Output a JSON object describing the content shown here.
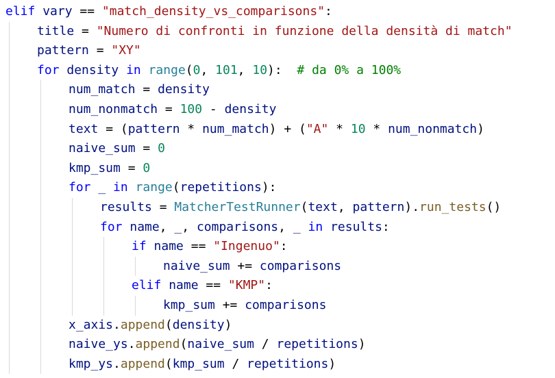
{
  "colors": {
    "keyword": "#0000ff",
    "control": "#8f08c4",
    "identifier": "#001080",
    "string": "#a31515",
    "number": "#098658",
    "comment": "#008000",
    "function": "#795e26",
    "class": "#267f99",
    "plain": "#000000",
    "guide": "#d9d9d9"
  },
  "lines": [
    {
      "indent": 0,
      "tokens": [
        {
          "t": "elif",
          "k": "keyword"
        },
        {
          "t": " ",
          "k": "plain"
        },
        {
          "t": "vary",
          "k": "identifier"
        },
        {
          "t": " == ",
          "k": "plain"
        },
        {
          "t": "\"match_density_vs_comparisons\"",
          "k": "string"
        },
        {
          "t": ":",
          "k": "plain"
        }
      ]
    },
    {
      "indent": 1,
      "tokens": [
        {
          "t": "title",
          "k": "identifier"
        },
        {
          "t": " = ",
          "k": "plain"
        },
        {
          "t": "\"Numero di confronti in funzione della densità di match\"",
          "k": "string"
        }
      ]
    },
    {
      "indent": 1,
      "tokens": [
        {
          "t": "pattern",
          "k": "identifier"
        },
        {
          "t": " = ",
          "k": "plain"
        },
        {
          "t": "\"XY\"",
          "k": "string"
        }
      ]
    },
    {
      "indent": 1,
      "tokens": [
        {
          "t": "for",
          "k": "keyword"
        },
        {
          "t": " ",
          "k": "plain"
        },
        {
          "t": "density",
          "k": "identifier"
        },
        {
          "t": " ",
          "k": "plain"
        },
        {
          "t": "in",
          "k": "keyword"
        },
        {
          "t": " ",
          "k": "plain"
        },
        {
          "t": "range",
          "k": "class"
        },
        {
          "t": "(",
          "k": "plain"
        },
        {
          "t": "0",
          "k": "number"
        },
        {
          "t": ", ",
          "k": "plain"
        },
        {
          "t": "101",
          "k": "number"
        },
        {
          "t": ", ",
          "k": "plain"
        },
        {
          "t": "10",
          "k": "number"
        },
        {
          "t": "):  ",
          "k": "plain"
        },
        {
          "t": "# da 0% a 100%",
          "k": "comment"
        }
      ]
    },
    {
      "indent": 2,
      "tokens": [
        {
          "t": "num_match",
          "k": "identifier"
        },
        {
          "t": " = ",
          "k": "plain"
        },
        {
          "t": "density",
          "k": "identifier"
        }
      ]
    },
    {
      "indent": 2,
      "tokens": [
        {
          "t": "num_nonmatch",
          "k": "identifier"
        },
        {
          "t": " = ",
          "k": "plain"
        },
        {
          "t": "100",
          "k": "number"
        },
        {
          "t": " - ",
          "k": "plain"
        },
        {
          "t": "density",
          "k": "identifier"
        }
      ]
    },
    {
      "indent": 2,
      "tokens": [
        {
          "t": "text",
          "k": "identifier"
        },
        {
          "t": " = (",
          "k": "plain"
        },
        {
          "t": "pattern",
          "k": "identifier"
        },
        {
          "t": " * ",
          "k": "plain"
        },
        {
          "t": "num_match",
          "k": "identifier"
        },
        {
          "t": ") + (",
          "k": "plain"
        },
        {
          "t": "\"A\"",
          "k": "string"
        },
        {
          "t": " * ",
          "k": "plain"
        },
        {
          "t": "10",
          "k": "number"
        },
        {
          "t": " * ",
          "k": "plain"
        },
        {
          "t": "num_nonmatch",
          "k": "identifier"
        },
        {
          "t": ")",
          "k": "plain"
        }
      ]
    },
    {
      "indent": 2,
      "tokens": [
        {
          "t": "naive_sum",
          "k": "identifier"
        },
        {
          "t": " = ",
          "k": "plain"
        },
        {
          "t": "0",
          "k": "number"
        }
      ]
    },
    {
      "indent": 2,
      "tokens": [
        {
          "t": "kmp_sum",
          "k": "identifier"
        },
        {
          "t": " = ",
          "k": "plain"
        },
        {
          "t": "0",
          "k": "number"
        }
      ]
    },
    {
      "indent": 2,
      "tokens": [
        {
          "t": "for",
          "k": "keyword"
        },
        {
          "t": " ",
          "k": "plain"
        },
        {
          "t": "_",
          "k": "identifier"
        },
        {
          "t": " ",
          "k": "plain"
        },
        {
          "t": "in",
          "k": "keyword"
        },
        {
          "t": " ",
          "k": "plain"
        },
        {
          "t": "range",
          "k": "class"
        },
        {
          "t": "(",
          "k": "plain"
        },
        {
          "t": "repetitions",
          "k": "identifier"
        },
        {
          "t": "):",
          "k": "plain"
        }
      ]
    },
    {
      "indent": 3,
      "tokens": [
        {
          "t": "results",
          "k": "identifier"
        },
        {
          "t": " = ",
          "k": "plain"
        },
        {
          "t": "MatcherTestRunner",
          "k": "class"
        },
        {
          "t": "(",
          "k": "plain"
        },
        {
          "t": "text",
          "k": "identifier"
        },
        {
          "t": ", ",
          "k": "plain"
        },
        {
          "t": "pattern",
          "k": "identifier"
        },
        {
          "t": ").",
          "k": "plain"
        },
        {
          "t": "run_tests",
          "k": "function"
        },
        {
          "t": "()",
          "k": "plain"
        }
      ]
    },
    {
      "indent": 3,
      "tokens": [
        {
          "t": "for",
          "k": "keyword"
        },
        {
          "t": " ",
          "k": "plain"
        },
        {
          "t": "name",
          "k": "identifier"
        },
        {
          "t": ", ",
          "k": "plain"
        },
        {
          "t": "_",
          "k": "identifier"
        },
        {
          "t": ", ",
          "k": "plain"
        },
        {
          "t": "comparisons",
          "k": "identifier"
        },
        {
          "t": ", ",
          "k": "plain"
        },
        {
          "t": "_",
          "k": "identifier"
        },
        {
          "t": " ",
          "k": "plain"
        },
        {
          "t": "in",
          "k": "keyword"
        },
        {
          "t": " ",
          "k": "plain"
        },
        {
          "t": "results",
          "k": "identifier"
        },
        {
          "t": ":",
          "k": "plain"
        }
      ]
    },
    {
      "indent": 4,
      "tokens": [
        {
          "t": "if",
          "k": "keyword"
        },
        {
          "t": " ",
          "k": "plain"
        },
        {
          "t": "name",
          "k": "identifier"
        },
        {
          "t": " == ",
          "k": "plain"
        },
        {
          "t": "\"Ingenuo\"",
          "k": "string"
        },
        {
          "t": ":",
          "k": "plain"
        }
      ]
    },
    {
      "indent": 5,
      "tokens": [
        {
          "t": "naive_sum",
          "k": "identifier"
        },
        {
          "t": " += ",
          "k": "plain"
        },
        {
          "t": "comparisons",
          "k": "identifier"
        }
      ]
    },
    {
      "indent": 4,
      "tokens": [
        {
          "t": "elif",
          "k": "keyword"
        },
        {
          "t": " ",
          "k": "plain"
        },
        {
          "t": "name",
          "k": "identifier"
        },
        {
          "t": " == ",
          "k": "plain"
        },
        {
          "t": "\"KMP\"",
          "k": "string"
        },
        {
          "t": ":",
          "k": "plain"
        }
      ]
    },
    {
      "indent": 5,
      "tokens": [
        {
          "t": "kmp_sum",
          "k": "identifier"
        },
        {
          "t": " += ",
          "k": "plain"
        },
        {
          "t": "comparisons",
          "k": "identifier"
        }
      ]
    },
    {
      "indent": 2,
      "tokens": [
        {
          "t": "x_axis",
          "k": "identifier"
        },
        {
          "t": ".",
          "k": "plain"
        },
        {
          "t": "append",
          "k": "function"
        },
        {
          "t": "(",
          "k": "plain"
        },
        {
          "t": "density",
          "k": "identifier"
        },
        {
          "t": ")",
          "k": "plain"
        }
      ]
    },
    {
      "indent": 2,
      "tokens": [
        {
          "t": "naive_ys",
          "k": "identifier"
        },
        {
          "t": ".",
          "k": "plain"
        },
        {
          "t": "append",
          "k": "function"
        },
        {
          "t": "(",
          "k": "plain"
        },
        {
          "t": "naive_sum",
          "k": "identifier"
        },
        {
          "t": " / ",
          "k": "plain"
        },
        {
          "t": "repetitions",
          "k": "identifier"
        },
        {
          "t": ")",
          "k": "plain"
        }
      ]
    },
    {
      "indent": 2,
      "tokens": [
        {
          "t": "kmp_ys",
          "k": "identifier"
        },
        {
          "t": ".",
          "k": "plain"
        },
        {
          "t": "append",
          "k": "function"
        },
        {
          "t": "(",
          "k": "plain"
        },
        {
          "t": "kmp_sum",
          "k": "identifier"
        },
        {
          "t": " / ",
          "k": "plain"
        },
        {
          "t": "repetitions",
          "k": "identifier"
        },
        {
          "t": ")",
          "k": "plain"
        }
      ]
    }
  ]
}
